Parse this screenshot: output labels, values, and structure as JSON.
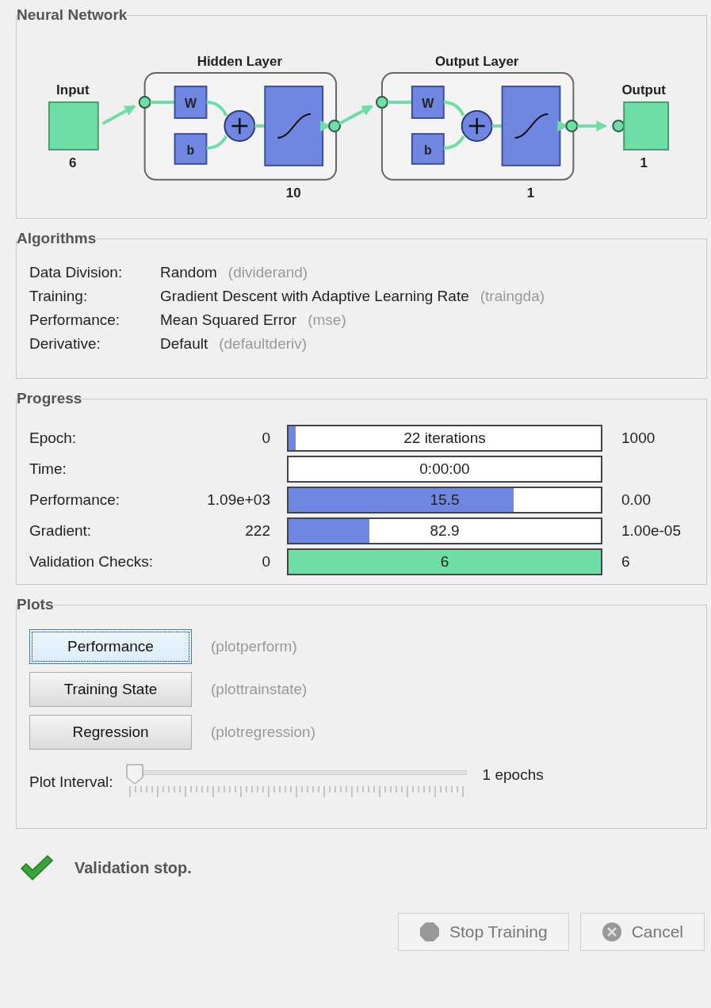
{
  "network": {
    "title": "Neural Network",
    "input": {
      "label": "Input",
      "size": "6"
    },
    "layers": [
      {
        "title": "Hidden Layer",
        "weight_label": "W",
        "bias_label": "b",
        "size": "10"
      },
      {
        "title": "Output Layer",
        "weight_label": "W",
        "bias_label": "b",
        "size": "1"
      }
    ],
    "output": {
      "label": "Output",
      "size": "1"
    }
  },
  "algorithms": {
    "title": "Algorithms",
    "rows": [
      {
        "label": "Data Division:",
        "value": "Random",
        "function": "(dividerand)"
      },
      {
        "label": "Training:",
        "value": "Gradient Descent with Adaptive Learning Rate",
        "function": "(traingda)"
      },
      {
        "label": "Performance:",
        "value": "Mean Squared Error",
        "function": "(mse)"
      },
      {
        "label": "Derivative:",
        "value": "Default",
        "function": "(defaultderiv)"
      }
    ]
  },
  "progress": {
    "title": "Progress",
    "rows": [
      {
        "label": "Epoch:",
        "start": "0",
        "reading": "22 iterations",
        "end": "1000",
        "level": 0.022,
        "color": "#6f87e0"
      },
      {
        "label": "Time:",
        "reading": "0:00:00"
      },
      {
        "label": "Performance:",
        "start": "1.09e+03",
        "reading": "15.5",
        "end": "0.00",
        "level": 0.72,
        "color": "#6f87e0"
      },
      {
        "label": "Gradient:",
        "start": "222",
        "reading": "82.9",
        "end": "1.00e-05",
        "level": 0.26,
        "color": "#6f87e0"
      },
      {
        "label": "Validation Checks:",
        "start": "0",
        "reading": "6",
        "end": "6",
        "level": 1,
        "color": "#6fdea6"
      }
    ]
  },
  "plots": {
    "title": "Plots",
    "buttons": [
      {
        "label": "Performance",
        "function": "(plotperform)",
        "focused": true
      },
      {
        "label": "Training State",
        "function": "(plottrainstate)",
        "focused": false
      },
      {
        "label": "Regression",
        "function": "(plotregression)",
        "focused": false
      }
    ],
    "interval": {
      "label": "Plot Interval:",
      "level": 0,
      "reading": "1 epochs"
    }
  },
  "status": {
    "message": "Validation stop."
  },
  "buttons": [
    {
      "label": "Stop Training",
      "kind": "stop",
      "disabled": true
    },
    {
      "label": "Cancel",
      "kind": "cancel",
      "disabled": true
    }
  ]
}
